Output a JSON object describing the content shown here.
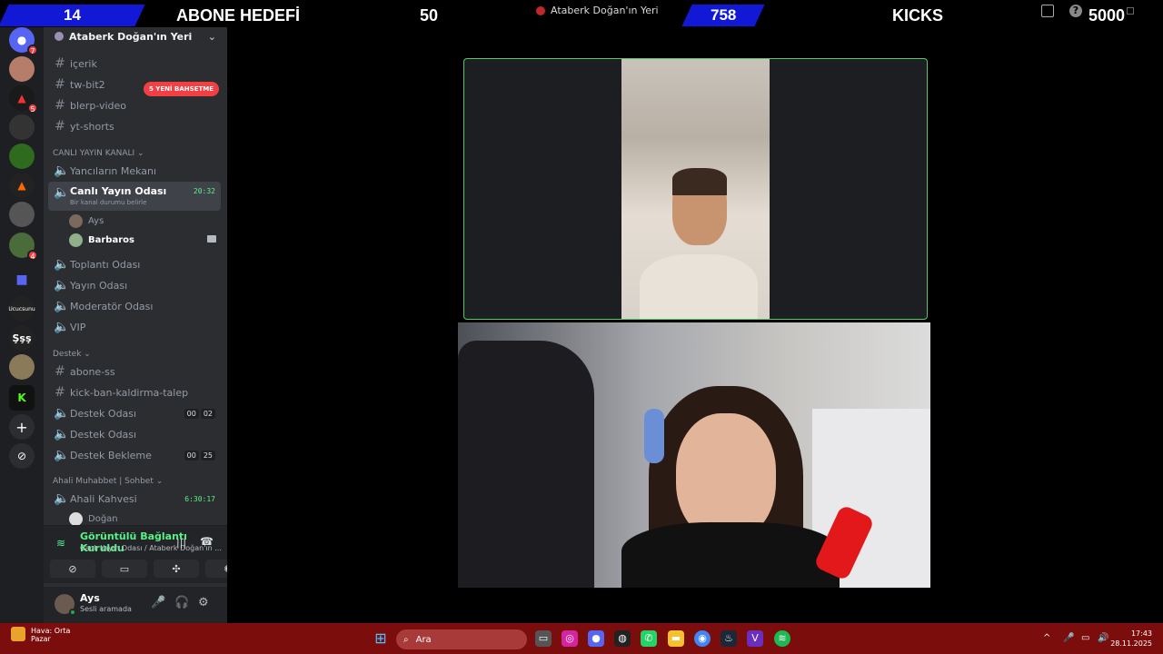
{
  "topbar": {
    "subs_current": "14",
    "subs_label": "ABONE HEDEFİ",
    "subs_goal": "50",
    "kicks_current": "758",
    "kicks_label": "KICKS",
    "kicks_goal": "5000",
    "window_title": "Ataberk Doğan'ın Yeri"
  },
  "servers": [
    {
      "name": "discord-home-icon",
      "badge": "7"
    },
    {
      "name": "server-avatar-1",
      "badge": ""
    },
    {
      "name": "server-avatar-2",
      "badge": "5"
    },
    {
      "name": "server-avatar-3",
      "badge": ""
    },
    {
      "name": "server-avatar-4",
      "badge": ""
    },
    {
      "name": "server-avatar-5",
      "badge": ""
    },
    {
      "name": "server-avatar-6",
      "badge": ""
    },
    {
      "name": "server-avatar-7",
      "badge": "4"
    },
    {
      "name": "folder-icon",
      "badge": ""
    },
    {
      "name": "server-text-1",
      "text": "Ucucsunu"
    },
    {
      "name": "server-text-2",
      "text": "Şşş"
    },
    {
      "name": "server-avatar-8",
      "badge": ""
    },
    {
      "name": "server-kick",
      "text": "K"
    },
    {
      "name": "add-server-icon",
      "text": "+"
    },
    {
      "name": "explore-icon",
      "text": "⊘"
    }
  ],
  "sidebar": {
    "server_name": "Ataberk Doğan'ın Yeri",
    "mention_badge": "5 YENİ BAHSETME",
    "channels": [
      {
        "label": "içerik",
        "type": "text"
      },
      {
        "label": "tw-bit2",
        "type": "text"
      },
      {
        "label": "blerp-video",
        "type": "text"
      },
      {
        "label": "yt-shorts",
        "type": "text"
      }
    ],
    "cat_live": "CANLI YAYIN KANALI",
    "voice_live": [
      {
        "label": "Yancıların Mekanı"
      },
      {
        "label": "Canlı Yayın Odası",
        "time": "20:32",
        "sub": "Bir kanal durumu belirle"
      },
      {
        "label": "Toplantı Odası"
      },
      {
        "label": "Yayın Odası"
      },
      {
        "label": "Moderatör Odası"
      },
      {
        "label": "VIP"
      }
    ],
    "members": [
      {
        "name": "Ays"
      },
      {
        "name": "Barbaros"
      }
    ],
    "cat_support": "Destek",
    "support": [
      {
        "label": "abone-ss",
        "type": "text"
      },
      {
        "label": "kick-ban-kaldirma-talep",
        "type": "text"
      },
      {
        "label": "Destek Odası",
        "c1": "00",
        "c2": "02"
      },
      {
        "label": "Destek Odası"
      },
      {
        "label": "Destek Bekleme",
        "c1": "00",
        "c2": "25"
      }
    ],
    "cat_chat": "Ahali Muhabbet | Sohbet",
    "chat_channel": {
      "label": "Ahali Kahvesi",
      "time": "6:30:17"
    },
    "chat_member": "Doğan"
  },
  "voice_panel": {
    "status": "Görüntülü Bağlantı Kuruldu",
    "channel": "Canlı Yayın Odası / Ataberk Doğan'ın ..."
  },
  "user_panel": {
    "name": "Ays",
    "status": "Sesli aramada"
  },
  "taskbar": {
    "weather_title": "Hava: Orta",
    "weather_sub": "Pazar",
    "search_placeholder": "Ara",
    "time": "17:43",
    "date": "28.11.2025"
  }
}
